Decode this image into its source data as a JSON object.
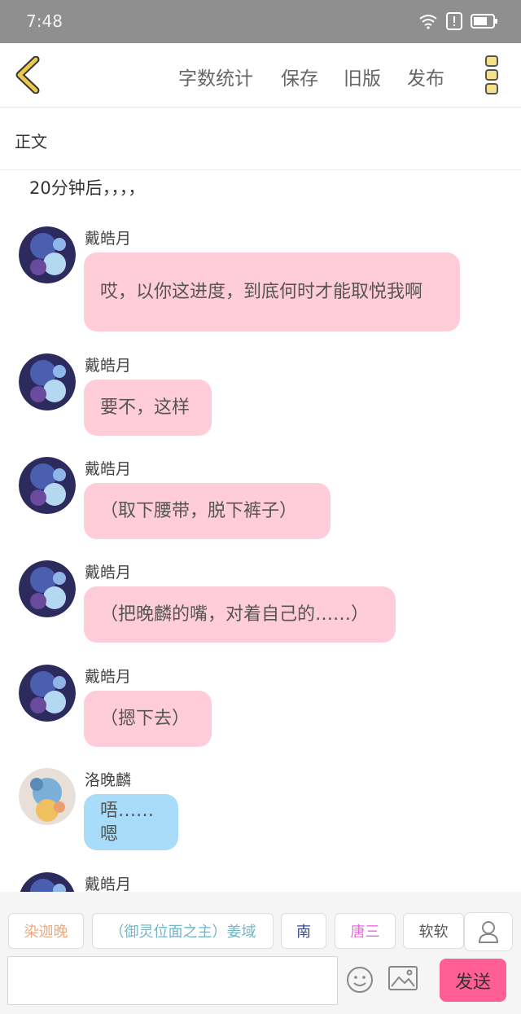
{
  "status_bar": {
    "time": "7:48"
  },
  "top_bar": {
    "back_icon": "chevron-left-icon",
    "links": [
      "字数统计",
      "保存",
      "旧版",
      "发布"
    ],
    "menu_icon": "more-vertical-icon"
  },
  "section_label": "正文",
  "narration": "20分钟后，，，，",
  "messages": [
    {
      "sender": "戴皓月",
      "text": "哎，以你这进度，到底何时才能取悦我啊"
    },
    {
      "sender": "戴皓月",
      "text": "要不，这样"
    },
    {
      "sender": "戴皓月",
      "text": "（取下腰带，脱下裤子）"
    },
    {
      "sender": "戴皓月",
      "text": "（把晚麟的嘴，对着自己的……）"
    },
    {
      "sender": "戴皓月",
      "text": "（摁下去）"
    },
    {
      "sender": "洛晚麟",
      "text": "唔……嗯"
    },
    {
      "sender": "戴皓月",
      "text": ""
    }
  ],
  "characters": [
    "染迦晚",
    "（御灵位面之主）姜域",
    "南",
    "唐三",
    "软软"
  ],
  "character_colors": [
    "#f0a878",
    "#6fb6c8",
    "#3a4a8c",
    "#e86bd8",
    "#555555"
  ],
  "input": {
    "placeholder": ""
  },
  "send_label": "发送",
  "colors": {
    "accent": "#ff5f95",
    "bubble_pink": "#ffccd9",
    "bubble_blue": "#a8dcf8",
    "back_icon": "#e8c94a"
  }
}
